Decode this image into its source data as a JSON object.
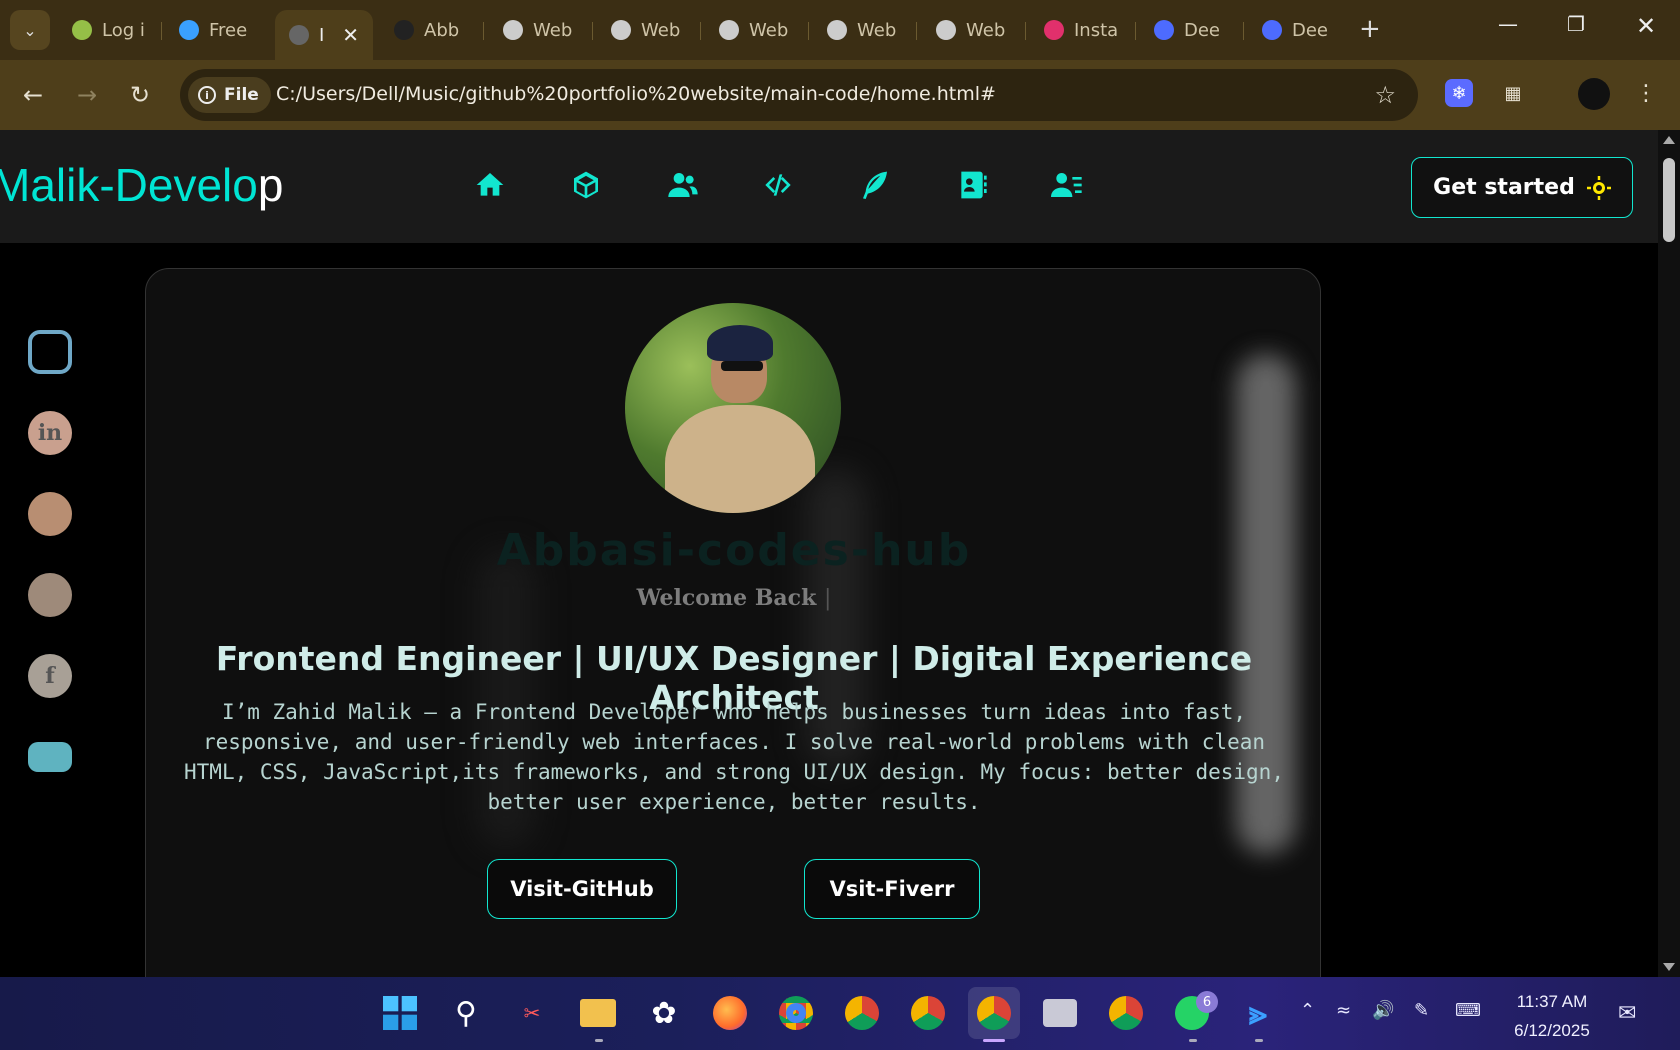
{
  "browser": {
    "tabs": [
      {
        "title": "Log i",
        "icon": "shopify-icon",
        "color": "#95bf47"
      },
      {
        "title": "Free",
        "icon": "heart-icon",
        "color": "#3aa0ff"
      },
      {
        "title": "I",
        "icon": "site-icon",
        "color": "#666666",
        "active": true
      },
      {
        "title": "Abb",
        "icon": "github-icon",
        "color": "#222222"
      },
      {
        "title": "Web",
        "icon": "globe-icon",
        "color": "#cccccc"
      },
      {
        "title": "Web",
        "icon": "globe-icon",
        "color": "#cccccc"
      },
      {
        "title": "Web",
        "icon": "globe-icon",
        "color": "#cccccc"
      },
      {
        "title": "Web",
        "icon": "globe-icon",
        "color": "#cccccc"
      },
      {
        "title": "Web",
        "icon": "globe-icon",
        "color": "#cccccc"
      },
      {
        "title": "Insta",
        "icon": "instagram-icon",
        "color": "#e1306c"
      },
      {
        "title": "Dee",
        "icon": "deepseek-icon",
        "color": "#4d6bfe"
      },
      {
        "title": "Dee",
        "icon": "deepseek-icon",
        "color": "#4d6bfe"
      }
    ],
    "new_tab": "+",
    "site_chip": "File",
    "url": "C:/Users/Dell/Music/github%20portfolio%20website/main-code/home.html#"
  },
  "site": {
    "logo_main": "Malik-Develo",
    "logo_tail": "p",
    "nav": [
      {
        "name": "home"
      },
      {
        "name": "projects"
      },
      {
        "name": "about"
      },
      {
        "name": "code"
      },
      {
        "name": "skills"
      },
      {
        "name": "contact-book"
      },
      {
        "name": "profile"
      }
    ],
    "cta_label": "Get started",
    "socials": [
      {
        "name": "instagram",
        "glyph": "",
        "bg": "#6fa8c7"
      },
      {
        "name": "linkedin",
        "glyph": "in",
        "bg": "#c9a08e"
      },
      {
        "name": "telegram",
        "glyph": "",
        "bg": "#b88e72"
      },
      {
        "name": "twitter",
        "glyph": "",
        "bg": "#9e8a7a"
      },
      {
        "name": "facebook",
        "glyph": "f",
        "bg": "#a8a096"
      },
      {
        "name": "youtube",
        "glyph": "",
        "bg": "#5fb3c0"
      }
    ],
    "brand_name": "Abbasi-codes-hub",
    "welcome": "Welcome Back",
    "caret": "|",
    "headline": "Frontend Engineer | UI/UX Designer | Digital Experience Architect",
    "bio": "I’m Zahid Malik — a Frontend Developer who helps businesses turn ideas into fast, responsive, and user-friendly web interfaces. I solve real-world problems with clean HTML, CSS, JavaScript,its frameworks, and strong UI/UX design. My focus: better design, better user experience, better results.",
    "btn_github": "Visit-GitHub",
    "btn_fiverr": "Vsit-Fiverr"
  },
  "taskbar": {
    "whatsapp_badge": "6",
    "time": "11:37 AM",
    "date": "6/12/2025"
  },
  "colors": {
    "accent": "#12e6cf",
    "logo": "#00e5d4"
  }
}
